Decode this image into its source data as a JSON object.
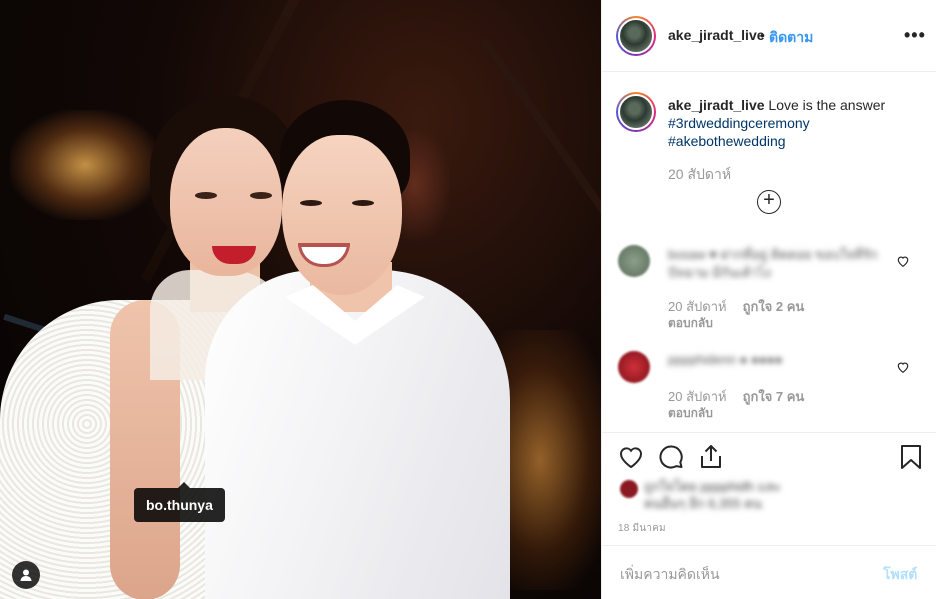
{
  "photo": {
    "tagged_user": "bo.thunya",
    "user_tag_icon": "person-icon"
  },
  "header": {
    "username": "ake_jiradt_live",
    "separator": "•",
    "follow_label": "ติดตาม",
    "more_icon": "more-options-icon",
    "more_label": "•••"
  },
  "caption": {
    "username": "ake_jiradt_live",
    "text": "Love is the answer",
    "hashtag1": "#3rdweddingceremony",
    "hashtag2": "#akebothewedding",
    "time_ago": "20 สัปดาห์",
    "load_more_label": "+"
  },
  "comments": [
    {
      "text": "bosaw ♥ ฝากที่อยู่ ติดตอย ขอบใจที่รัก ปัจฉาม มีกันเค้าไง",
      "time": "20 สัปดาห์",
      "likes": "ถูกใจ 2 คน",
      "reply": "ตอบกลับ"
    },
    {
      "text": "pppphidenn ● ●●●●",
      "time": "20 สัปดาห์",
      "likes": "ถูกใจ 7 คน",
      "reply": "ตอบกลับ"
    }
  ],
  "likes": {
    "line1": "ถูกใจโดย pppphidh และ",
    "line2": "คนอื่นๆ อีก 6,355 คน"
  },
  "date": "18 มีนาคม",
  "add_comment": {
    "placeholder": "เพิ่มความคิดเห็น",
    "post_label": "โพสต์"
  },
  "colors": {
    "link": "#3897f0",
    "hashtag": "#003569",
    "muted": "#999999",
    "post_disabled": "#b2dffc"
  }
}
